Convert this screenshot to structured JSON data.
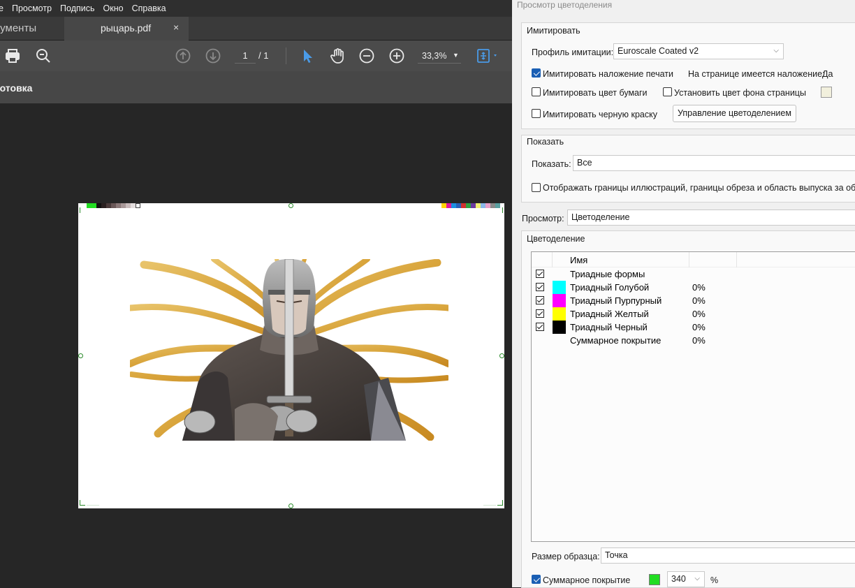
{
  "menu": [
    "е",
    "Просмотр",
    "Подпись",
    "Окно",
    "Справка"
  ],
  "tabs": {
    "tools": "рументы",
    "doc_title": "рыцарь.pdf",
    "close_glyph": "×"
  },
  "toolbar": {
    "page_current": "1",
    "page_total": "/ 1",
    "zoom": "33,3%"
  },
  "subbar": {
    "label": "готовка"
  },
  "panel": {
    "title": "Просмотр цветоделения",
    "simulate": {
      "heading": "Имитировать",
      "profile_label": "Профиль имитации:",
      "profile_value": "Euroscale Coated v2",
      "overprint_label": "Имитировать наложение печати",
      "overprint_checked": true,
      "page_overprint_label": "На странице имеется наложение:",
      "page_overprint_value": "Да",
      "paper_color_label": "Имитировать цвет бумаги",
      "paper_color_checked": false,
      "page_bg_label": "Установить цвет фона страницы",
      "page_bg_checked": false,
      "page_bg_swatch": "#f2f0dd",
      "black_ink_label": "Имитировать черную краску",
      "black_ink_checked": false,
      "color_mgmt_button": "Управление цветоделением"
    },
    "show": {
      "heading": "Показать",
      "show_label": "Показать:",
      "show_value": "Все",
      "boxes_label": "Отображать границы иллюстраций, границы обреза и область выпуска за обрез",
      "boxes_checked": false
    },
    "preview": {
      "label": "Просмотр:",
      "value": "Цветоделение"
    },
    "separations": {
      "heading": "Цветоделение",
      "column_name": "Имя",
      "rows": [
        {
          "name": "Триадные формы",
          "swatch": "",
          "percent": "",
          "checked": true
        },
        {
          "name": "Триадный Голубой",
          "swatch": "#00ffff",
          "percent": "0%",
          "checked": true
        },
        {
          "name": "Триадный Пурпурный",
          "swatch": "#ff00ff",
          "percent": "0%",
          "checked": true
        },
        {
          "name": "Триадный Желтый",
          "swatch": "#ffff00",
          "percent": "0%",
          "checked": true
        },
        {
          "name": "Триадный Черный",
          "swatch": "#000000",
          "percent": "0%",
          "checked": true
        },
        {
          "name": "Суммарное покрытие",
          "swatch": "",
          "percent": "0%",
          "checked": false
        }
      ]
    },
    "sample": {
      "label": "Размер образца:",
      "value": "Точка"
    },
    "total_coverage": {
      "label": "Суммарное покрытие",
      "checked": true,
      "swatch": "#22dd22",
      "value": "340",
      "unit": "%"
    }
  },
  "colors": {
    "accent": "#1a5fb4",
    "registration": "#2a8a2a",
    "tool_select": "#4a9be8"
  }
}
